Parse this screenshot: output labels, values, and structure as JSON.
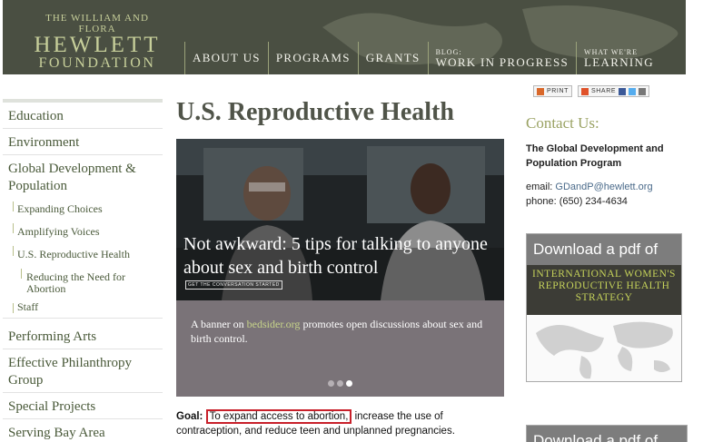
{
  "header": {
    "logo": {
      "line1": "THE WILLIAM AND FLORA",
      "line2": "HEWLETT",
      "line3": "FOUNDATION"
    },
    "nav": [
      {
        "small": "",
        "label": "ABOUT US"
      },
      {
        "small": "",
        "label": "PROGRAMS"
      },
      {
        "small": "",
        "label": "GRANTS"
      },
      {
        "small": "BLOG:",
        "label": "WORK IN PROGRESS"
      },
      {
        "small": "WHAT WE'RE",
        "label": "LEARNING"
      }
    ]
  },
  "sharebar": {
    "print_label": "PRINT",
    "share_label": "SHARE"
  },
  "sidebar": {
    "items": [
      {
        "label": "Education"
      },
      {
        "label": "Environment"
      },
      {
        "label": "Global Development & Population"
      },
      {
        "label": "Expanding Choices"
      },
      {
        "label": "Amplifying Voices"
      },
      {
        "label": "U.S. Reproductive Health"
      },
      {
        "label": "Reducing the Need for Abortion"
      },
      {
        "label": "Staff"
      },
      {
        "label": "Performing Arts"
      },
      {
        "label": "Effective Philanthropy Group"
      },
      {
        "label": "Special Projects"
      },
      {
        "label": "Serving Bay Area Communities"
      }
    ]
  },
  "main": {
    "title": "U.S. Reproductive Health",
    "banner": {
      "headline": "Not awkward: 5 tips for talking to anyone about sex and birth control",
      "cta": "GET THE CONVERSATION STARTED"
    },
    "caption": {
      "prefix": "A banner on ",
      "link": "bedsider.org",
      "suffix": " promotes open discussions about sex and birth control."
    },
    "slider": {
      "count": 3,
      "active_index": 2
    },
    "goal": {
      "label": "Goal:",
      "highlight": "To expand access to abortion,",
      "rest": " increase the use of contraception, and reduce teen and unplanned pregnancies."
    }
  },
  "contact": {
    "heading": "Contact Us:",
    "program": "The Global Development and Population Program",
    "email_label": "email: ",
    "email": "GDandP@hewlett.org",
    "phone": "phone: (650) 234-4634"
  },
  "pdf": {
    "heading": "Download a pdf of",
    "strategy": "INTERNATIONAL WOMEN'S REPRODUCTIVE HEALTH STRATEGY",
    "heading2": "Download a pdf of"
  },
  "colors": {
    "header_bg": "#4a4f42",
    "accent": "#9aa263",
    "highlight_border": "#c8202a",
    "link": "#4a6a8a"
  }
}
